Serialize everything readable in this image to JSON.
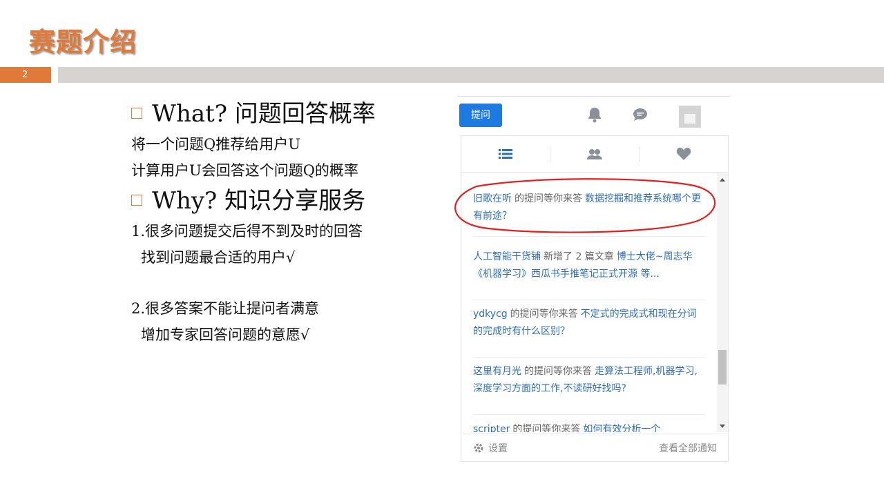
{
  "slide": {
    "title": "赛题介绍",
    "page_number": "2"
  },
  "content": {
    "what_heading": "What?  问题回答概率",
    "what_line1": "将一个问题Q推荐给用户U",
    "what_line2": "计算用户U会回答这个问题Q的概率",
    "why_heading": "Why?  知识分享服务",
    "why_point1": "1.很多问题提交后得不到及时的回答",
    "why_point1_sub": "找到问题最合适的用户√",
    "why_point2": "2.很多答案不能让提问者满意",
    "why_point2_sub": "增加专家回答问题的意愿√"
  },
  "panel": {
    "ask_button": "提问",
    "nav_icons": [
      "bell-icon",
      "chat-icon",
      "avatar"
    ],
    "tabs": [
      "list-icon",
      "users-icon",
      "heart-icon"
    ],
    "notifications": [
      {
        "user": "旧歌在听",
        "action": "的提问等你来答",
        "link": "数据挖掘和推荐系统哪个更有前途？"
      },
      {
        "user": "人工智能干货铺",
        "action": "新增了 2 篇文章",
        "link": "博士大佬~周志华《机器学习》西瓜书手推笔记正式开源 等..."
      },
      {
        "user": "ydkycg",
        "action": "的提问等你来答",
        "link": "不定式的完成式和现在分词的完成时有什么区别？"
      },
      {
        "user": "这里有月光",
        "action": "的提问等你来答",
        "link": "走算法工程师,机器学习,深度学习方面的工作,不读研好找吗?"
      },
      {
        "user": "scripter",
        "action": "的提问等你来答",
        "link": "如何有效分析一个"
      }
    ],
    "footer": {
      "settings": "设置",
      "view_all": "查看全部通知"
    }
  },
  "colors": {
    "accent_orange": "#e07a3a",
    "zhihu_blue": "#1e7ae0",
    "link_blue": "#2d6db7",
    "annotation_red": "#e02020"
  }
}
